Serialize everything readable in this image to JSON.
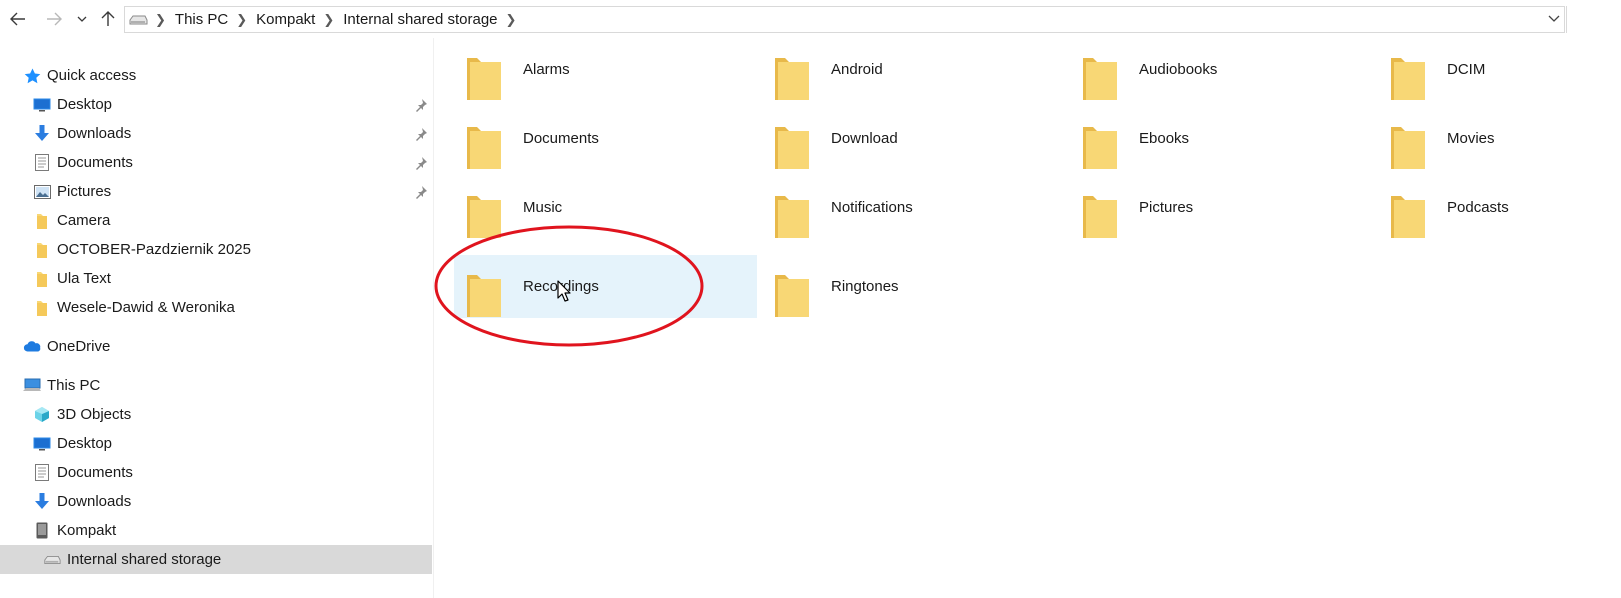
{
  "toolbar": {
    "back_icon": "back-arrow-icon",
    "forward_icon": "forward-arrow-icon",
    "recent_icon": "chevron-down-icon",
    "up_icon": "up-arrow-icon"
  },
  "address": {
    "crumbs": [
      "This PC",
      "Kompakt",
      "Internal shared storage"
    ]
  },
  "sidebar": {
    "quick_access": {
      "label": "Quick access",
      "items": [
        {
          "label": "Desktop",
          "pinned": true
        },
        {
          "label": "Downloads",
          "pinned": true
        },
        {
          "label": "Documents",
          "pinned": true
        },
        {
          "label": "Pictures",
          "pinned": true
        },
        {
          "label": "Camera",
          "pinned": false
        },
        {
          "label": "OCTOBER-Pazdziernik 2025",
          "pinned": false
        },
        {
          "label": "Ula Text",
          "pinned": false
        },
        {
          "label": "Wesele-Dawid & Weronika",
          "pinned": false
        }
      ]
    },
    "onedrive": {
      "label": "OneDrive"
    },
    "this_pc": {
      "label": "This PC",
      "items": [
        {
          "label": "3D Objects"
        },
        {
          "label": "Desktop"
        },
        {
          "label": "Documents"
        },
        {
          "label": "Downloads"
        },
        {
          "label": "Kompakt"
        }
      ],
      "selected_child": {
        "label": "Internal shared storage"
      }
    }
  },
  "content": {
    "folders": [
      "Alarms",
      "Android",
      "Audiobooks",
      "DCIM",
      "Documents",
      "Download",
      "Ebooks",
      "Movies",
      "Music",
      "Notifications",
      "Pictures",
      "Podcasts",
      "Recordings",
      "Ringtones"
    ],
    "hovered_folder": "Recordings"
  },
  "colors": {
    "folder_yellow": "#f8d775",
    "folder_dark": "#e8b94a",
    "hover_bg": "#e5f3fb",
    "selected_bg": "#d9d9d9",
    "annotation_red": "#e0141e",
    "star_blue": "#1e90ff"
  }
}
